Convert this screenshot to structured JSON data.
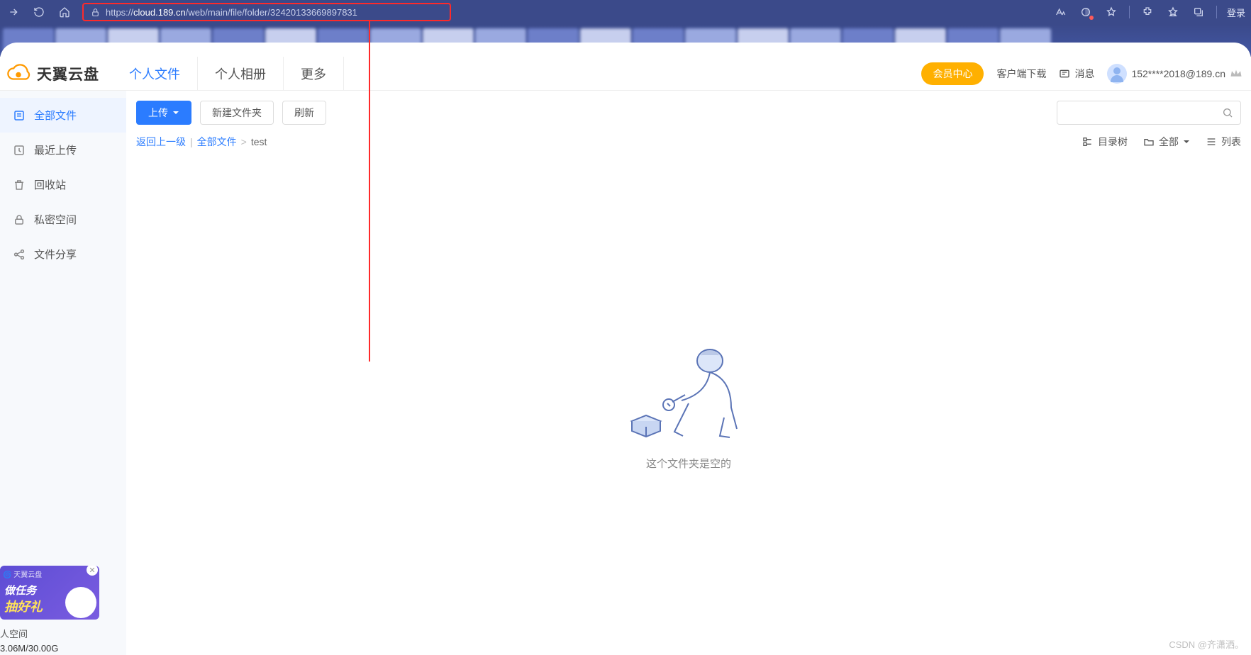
{
  "browser": {
    "url_prefix": "https://",
    "url_domain": "cloud.189.cn",
    "url_path": "/web/main/file/folder/32420133669897831",
    "login": "登录"
  },
  "header": {
    "logo_text": "天翼云盘",
    "tabs": [
      "个人文件",
      "个人相册",
      "更多"
    ],
    "active_tab": 0,
    "vip": "会员中心",
    "client": "客户端下载",
    "msg": "消息",
    "user": "152****2018@189.cn"
  },
  "sidebar": {
    "items": [
      {
        "label": "全部文件",
        "icon": "files"
      },
      {
        "label": "最近上传",
        "icon": "clock"
      },
      {
        "label": "回收站",
        "icon": "trash"
      },
      {
        "label": "私密空间",
        "icon": "lock"
      },
      {
        "label": "文件分享",
        "icon": "share"
      }
    ],
    "active": 0,
    "promo": {
      "tag": "🌀 天翼云盘",
      "line1": "做任务",
      "line2": "抽好礼"
    },
    "quota_label": "人空间",
    "quota_value": "3.06M/30.00G"
  },
  "toolbar": {
    "upload": "上传",
    "new_folder": "新建文件夹",
    "refresh": "刷新",
    "search_placeholder": ""
  },
  "breadcrumb": {
    "back": "返回上一级",
    "bar": "|",
    "root": "全部文件",
    "gt": ">",
    "current": "test",
    "tree": "目录树",
    "all": "全部",
    "list": "列表"
  },
  "empty": {
    "text": "这个文件夹是空的"
  },
  "watermark": "CSDN @齐潇洒。"
}
